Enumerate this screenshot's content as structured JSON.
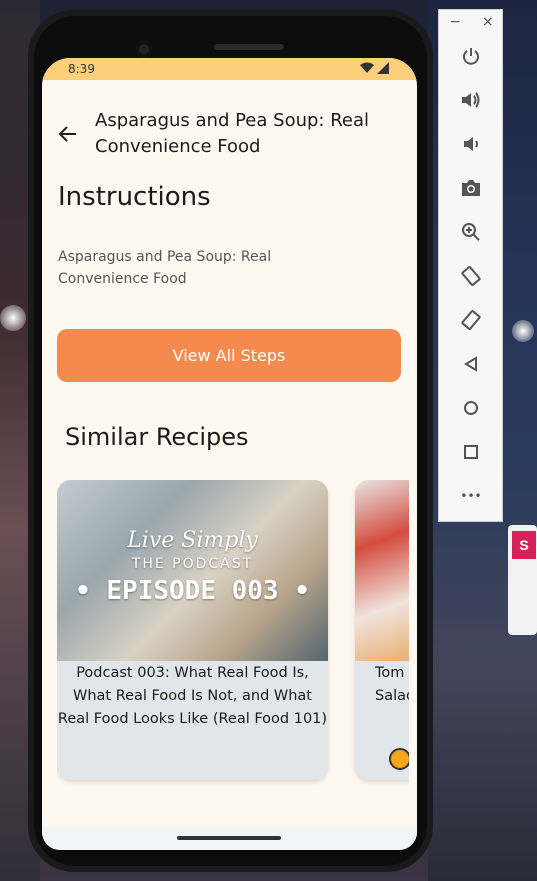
{
  "status_bar": {
    "time": "8:39"
  },
  "app_bar": {
    "title": "Asparagus and Pea Soup: Real Convenience Food"
  },
  "instructions": {
    "heading": "Instructions",
    "description": "Asparagus and Pea Soup: Real Convenience Food",
    "button_label": "View All Steps"
  },
  "similar": {
    "heading": "Similar Recipes",
    "cards": [
      {
        "overlay_line1": "Live Simply",
        "overlay_line2": "THE PODCAST",
        "overlay_line3": "• EPISODE 003 •",
        "title": "Podcast 003: What Real Food Is, What Real Food Is Not, and What Real Food Looks Like (Real Food 101)"
      },
      {
        "title_line1": "Tom",
        "title_line2": "Salad"
      }
    ]
  },
  "emulator": {
    "minimize_label": "−",
    "close_label": "×",
    "more_label": "•••"
  },
  "colors": {
    "accent": "#f58a4e",
    "status_bar": "#fccf7a",
    "background": "#fff8f0",
    "card": "#e0e6ea"
  },
  "background_sign": "S"
}
